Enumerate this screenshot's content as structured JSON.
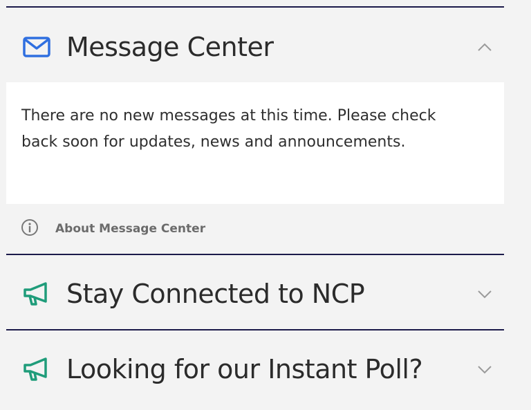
{
  "sections": [
    {
      "title": "Message Center",
      "icon": "envelope-icon",
      "expanded": true,
      "message": "There are no new messages at this time. Please check back soon for updates, news and announcements.",
      "about_label": "About Message Center",
      "about_icon": "info-circle-icon"
    },
    {
      "title": "Stay Connected to NCP",
      "icon": "megaphone-icon",
      "expanded": false
    },
    {
      "title": "Looking for our Instant Poll?",
      "icon": "megaphone-icon",
      "expanded": false
    }
  ],
  "colors": {
    "divider": "#1b1a4a",
    "envelope_icon": "#2f6fe0",
    "megaphone_icon": "#1f9c7a",
    "title_text": "#2b2b2b",
    "chevron": "#9a9a9a"
  }
}
